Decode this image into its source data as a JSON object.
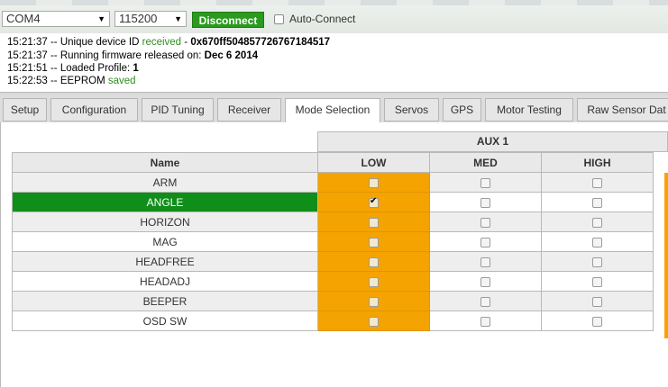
{
  "toolbar": {
    "port": "COM4",
    "baud": "115200",
    "disconnect_label": "Disconnect",
    "autoconnect_label": "Auto-Connect"
  },
  "log": [
    {
      "time": "15:21:37",
      "sep": " -- ",
      "text": "Unique device ID ",
      "highlight": "received",
      "rest": " - ",
      "bold": "0x670ff504857726767184517"
    },
    {
      "time": "15:21:37",
      "sep": " -- ",
      "text": "Running firmware released on: ",
      "bold": "Dec 6 2014"
    },
    {
      "time": "15:21:51",
      "sep": " -- ",
      "text": "Loaded Profile: ",
      "bold": "1"
    },
    {
      "time": "15:22:53",
      "sep": " -- ",
      "text": "EEPROM ",
      "highlight": "saved"
    }
  ],
  "tabs": [
    "Setup",
    "Configuration",
    "PID Tuning",
    "Receiver",
    "Mode Selection",
    "Servos",
    "GPS",
    "Motor Testing",
    "Raw Sensor Dat"
  ],
  "active_tab": "Mode Selection",
  "modes": {
    "aux_label": "AUX 1",
    "name_header": "Name",
    "columns": [
      "LOW",
      "MED",
      "HIGH"
    ],
    "rows": [
      {
        "name": "ARM",
        "low": false,
        "med": false,
        "high": false
      },
      {
        "name": "ANGLE",
        "low": true,
        "med": false,
        "high": false
      },
      {
        "name": "HORIZON",
        "low": false,
        "med": false,
        "high": false
      },
      {
        "name": "MAG",
        "low": false,
        "med": false,
        "high": false
      },
      {
        "name": "HEADFREE",
        "low": false,
        "med": false,
        "high": false
      },
      {
        "name": "HEADADJ",
        "low": false,
        "med": false,
        "high": false
      },
      {
        "name": "BEEPER",
        "low": false,
        "med": false,
        "high": false
      },
      {
        "name": "OSD SW",
        "low": false,
        "med": false,
        "high": false
      }
    ]
  },
  "colors": {
    "accent_green": "#2b9a1f",
    "active_mode": "#0f8f1a",
    "low_column": "#f5a300"
  }
}
